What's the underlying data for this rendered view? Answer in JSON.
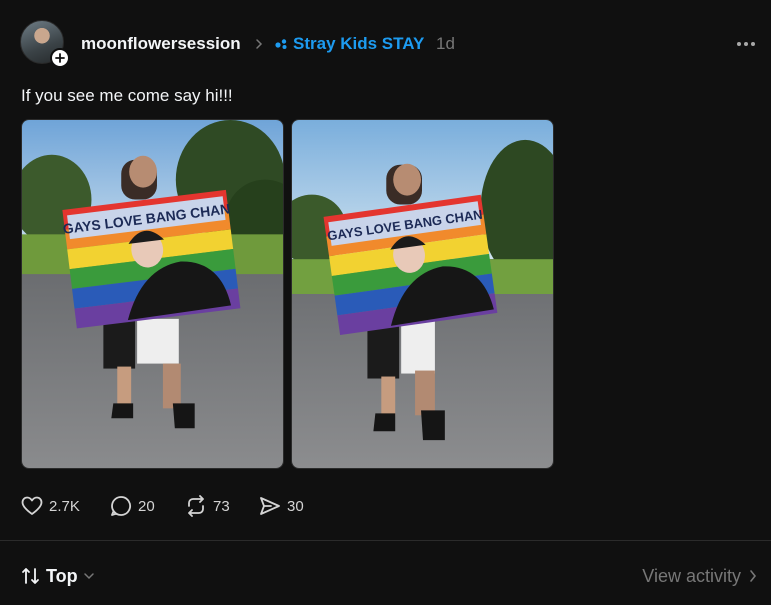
{
  "post": {
    "username": "moonflowersession",
    "community": "Stray Kids STAY",
    "timestamp": "1d",
    "text": "If you see me come say hi!!!",
    "photos": [
      {
        "flag_text": "GAYS LOVE BANG CHAN"
      },
      {
        "flag_text": "GAYS LOVE BANG CHAN"
      }
    ]
  },
  "actions": {
    "likes": "2.7K",
    "replies": "20",
    "reposts": "73",
    "shares": "30"
  },
  "footer": {
    "sort_label": "Top",
    "view_activity_label": "View activity"
  },
  "colors": {
    "background": "#101010",
    "community_accent": "#1d9bf0",
    "muted_text": "#777777"
  },
  "icons": [
    "plus-icon",
    "chevron-right-icon",
    "community-icon",
    "more-icon",
    "heart-icon",
    "comment-icon",
    "repost-icon",
    "share-icon",
    "sort-icon",
    "chevron-down-icon"
  ]
}
